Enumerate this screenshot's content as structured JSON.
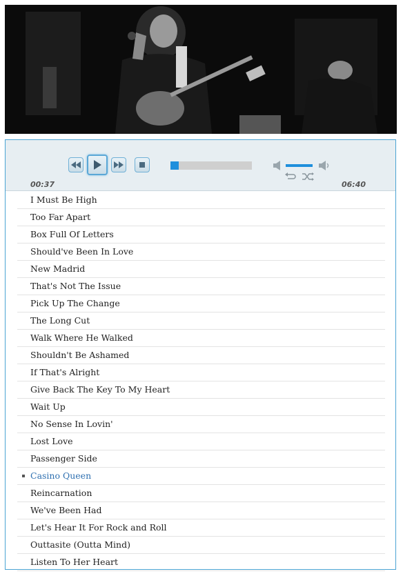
{
  "hero": {
    "image_name": "band-performance-photo"
  },
  "player": {
    "controls": {
      "previous_icon": "rewind-icon",
      "play_icon": "play-icon",
      "next_icon": "fast-forward-icon",
      "stop_icon": "stop-icon",
      "mute_icon": "speaker-mute-icon",
      "max_volume_icon": "speaker-max-icon",
      "repeat_icon": "repeat-icon",
      "shuffle_icon": "shuffle-icon"
    },
    "progress_fraction": 0.1,
    "volume_fraction": 1.0,
    "current_time": "00:37",
    "duration": "06:40",
    "accent_color": "#1f8fdc"
  },
  "playlist": {
    "current_index": 16,
    "tracks": [
      "I Must Be High",
      "Too Far Apart",
      "Box Full Of Letters",
      "Should've Been In Love",
      "New Madrid",
      "That's Not The Issue",
      "Pick Up The Change",
      "The Long Cut",
      "Walk Where He Walked",
      "Shouldn't Be Ashamed",
      "If That's Alright",
      "Give Back The Key To My Heart",
      "Wait Up",
      "No Sense In Lovin'",
      "Lost Love",
      "Passenger Side",
      "Casino Queen",
      "Reincarnation",
      "We've Been Had",
      "Let's Hear It For Rock and Roll",
      "Outtasite (Outta Mind)",
      "Listen To Her Heart"
    ]
  }
}
